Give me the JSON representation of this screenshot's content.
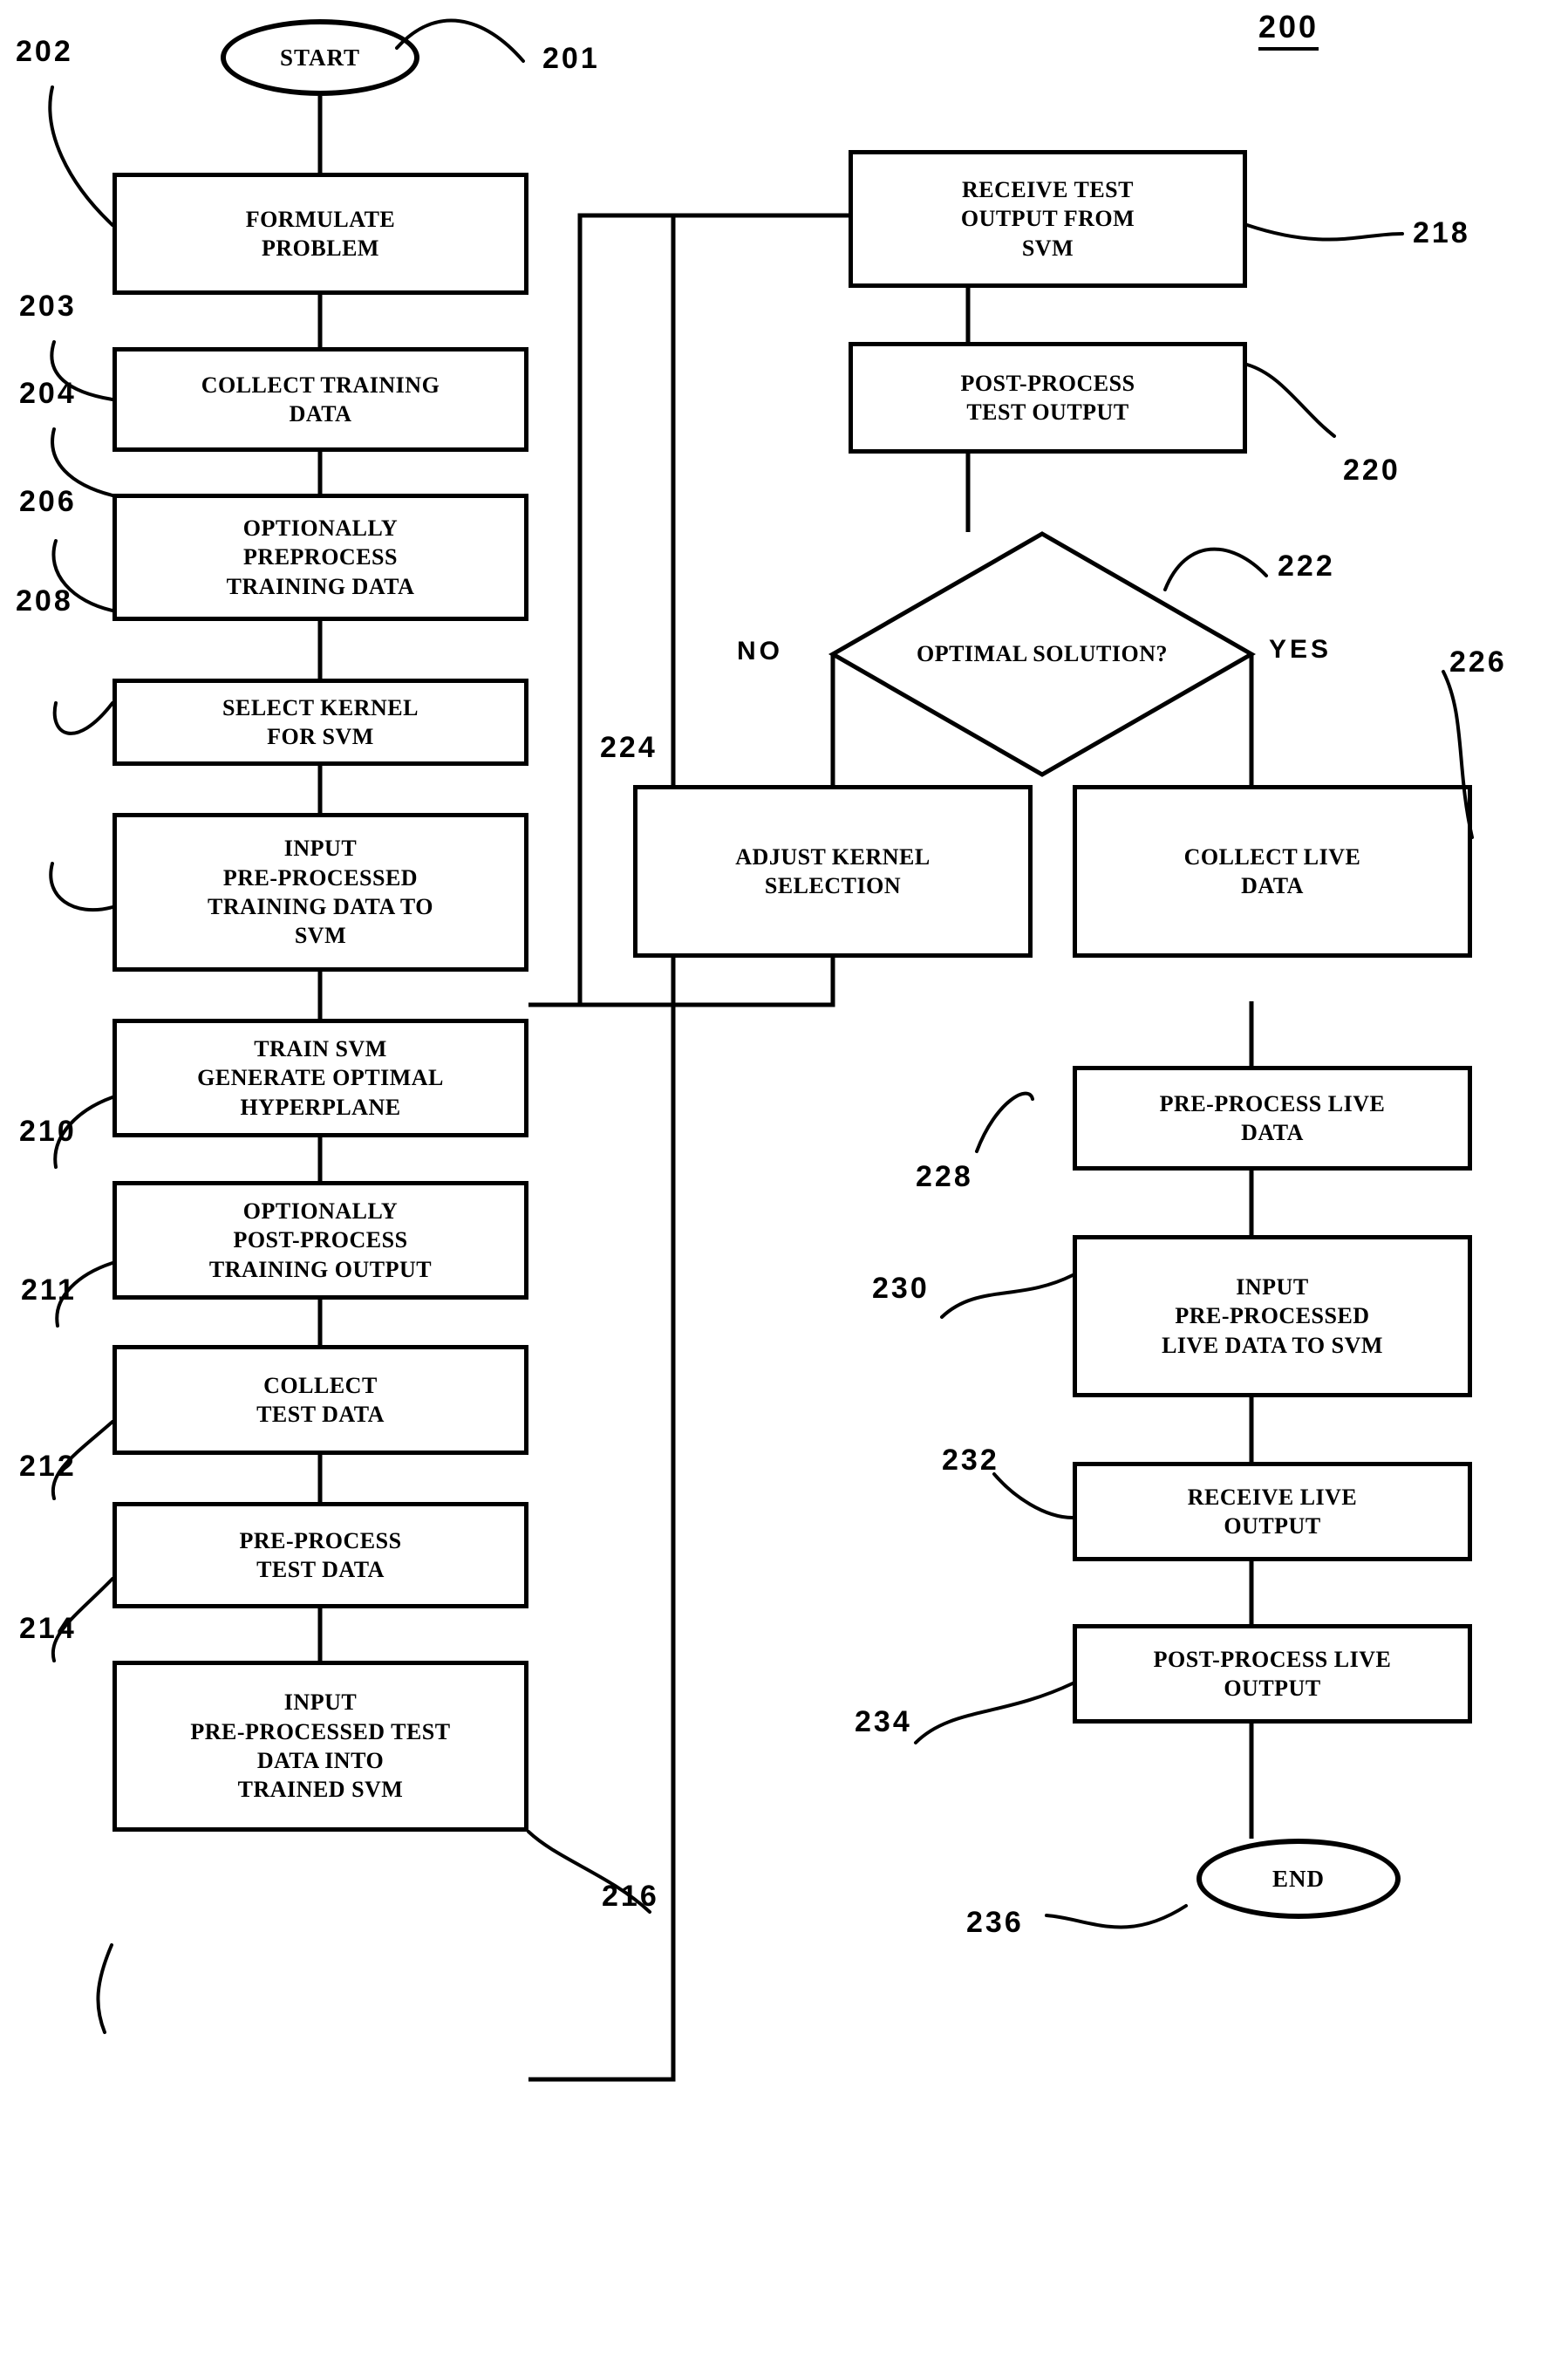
{
  "figure": {
    "number": "200"
  },
  "terminals": [
    {
      "id": "start",
      "label": "START",
      "ref": "201"
    },
    {
      "id": "end",
      "label": "END",
      "ref": "236"
    }
  ],
  "decision": {
    "label": "OPTIMAL SOLUTION?",
    "ref": "222",
    "no_label": "NO",
    "yes_label": "YES"
  },
  "steps": [
    {
      "id": "formulate",
      "ref": "202",
      "label": "FORMULATE\nPROBLEM"
    },
    {
      "id": "collect-training",
      "ref": "203",
      "label": "COLLECT TRAINING\nDATA"
    },
    {
      "id": "preprocess-training",
      "ref": "204",
      "label": "OPTIONALLY\nPREPROCESS\nTRAINING DATA"
    },
    {
      "id": "select-kernel",
      "ref": "206",
      "label": "SELECT KERNEL\nFOR SVM"
    },
    {
      "id": "input-training",
      "ref": "208",
      "label": "INPUT\nPRE-PROCESSED\nTRAINING DATA TO\nSVM"
    },
    {
      "id": "train-svm",
      "ref": "210",
      "label": "TRAIN SVM\nGENERATE OPTIMAL\nHYPERPLANE"
    },
    {
      "id": "postprocess-training",
      "ref": "211",
      "label": "OPTIONALLY\nPOST-PROCESS\nTRAINING OUTPUT"
    },
    {
      "id": "collect-test",
      "ref": "212",
      "label": "COLLECT\nTEST DATA"
    },
    {
      "id": "preprocess-test",
      "ref": "214",
      "label": "PRE-PROCESS\nTEST DATA"
    },
    {
      "id": "input-test",
      "ref": "216",
      "label": "INPUT\nPRE-PROCESSED TEST\nDATA INTO\nTRAINED SVM"
    },
    {
      "id": "receive-test-output",
      "ref": "218",
      "label": "RECEIVE TEST\nOUTPUT FROM\nSVM"
    },
    {
      "id": "postprocess-test",
      "ref": "220",
      "label": "POST-PROCESS\nTEST OUTPUT"
    },
    {
      "id": "adjust-kernel",
      "ref": "224",
      "label": "ADJUST KERNEL\nSELECTION"
    },
    {
      "id": "collect-live",
      "ref": "226",
      "label": "COLLECT LIVE\nDATA"
    },
    {
      "id": "preprocess-live",
      "ref": "228",
      "label": "PRE-PROCESS LIVE\nDATA"
    },
    {
      "id": "input-live",
      "ref": "230",
      "label": "INPUT\nPRE-PROCESSED\nLIVE DATA TO SVM"
    },
    {
      "id": "receive-live-output",
      "ref": "232",
      "label": "RECEIVE LIVE\nOUTPUT"
    },
    {
      "id": "postprocess-live",
      "ref": "234",
      "label": "POST-PROCESS LIVE\nOUTPUT"
    }
  ],
  "colors": {
    "ink": "#000000",
    "paper": "#ffffff"
  }
}
